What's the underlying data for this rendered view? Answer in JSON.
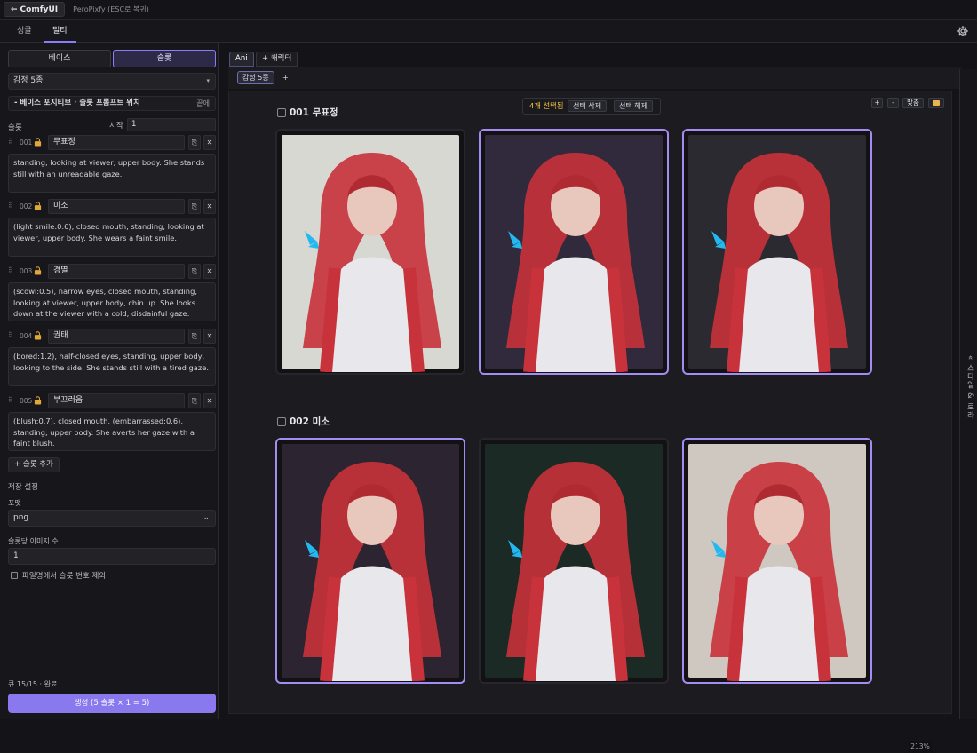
{
  "topbar": {
    "back_label": "ComfyUI",
    "app_title": "PeroPixfy (ESC로 복귀)"
  },
  "mode_tabs": [
    {
      "label": "싱글"
    },
    {
      "label": "멀티",
      "active": true
    }
  ],
  "left": {
    "seg_base": "베이스",
    "seg_slot": "슬롯",
    "preset": "감정 5종",
    "section_title": "베이스 포지티브 · 슬롯 프롬프트 위치",
    "section_fold": "끝에",
    "slot_label": "슬롯",
    "start_label": "시작",
    "start_value": "1",
    "slots": [
      {
        "num": "001",
        "name": "무표정",
        "prompt": "standing, looking at viewer, upper body. She stands still with an unreadable gaze."
      },
      {
        "num": "002",
        "name": "미소",
        "prompt": "(light smile:0.6), closed mouth, standing, looking at viewer, upper body. She wears a faint smile."
      },
      {
        "num": "003",
        "name": "경멸",
        "prompt": "(scowl:0.5), narrow eyes, closed mouth, standing, looking at viewer, upper body, chin up. She looks down at the viewer with a cold, disdainful gaze."
      },
      {
        "num": "004",
        "name": "권태",
        "prompt": "(bored:1.2), half-closed eyes, standing, upper body, looking to the side. She stands still with a tired gaze."
      },
      {
        "num": "005",
        "name": "부끄러움",
        "prompt": "(blush:0.7), closed mouth, (embarrassed:0.6), standing, upper body. She averts her gaze with a faint blush."
      }
    ],
    "add_slot": "+ 슬롯 추가",
    "save_settings": "저장 설정",
    "format_label": "포맷",
    "format_value": "png",
    "per_slot_label": "슬롯당 이미지 수",
    "per_slot_value": "1",
    "exclude_label": "파일명에서 슬롯 번호 제외",
    "queue_status": "큐 15/15 · 완료",
    "generate_label": "생성 (5 슬롯 × 1 = 5)"
  },
  "right": {
    "tabs": [
      {
        "label": "Ani",
        "active": true
      },
      {
        "label": "+ 캐릭터"
      }
    ],
    "subtabs": [
      {
        "label": "감정 5종",
        "active": true
      },
      {
        "label": "+"
      }
    ],
    "selection": {
      "count": "4개 선택됨",
      "delete": "선택 삭제",
      "clear": "선택 해제"
    },
    "zoom_controls": {
      "plus": "+",
      "minus": "-",
      "fit": "맞춤"
    },
    "groups": [
      {
        "title": "001 무표정",
        "cards": [
          {
            "selected": false,
            "bg": "#d8d8d2"
          },
          {
            "selected": true,
            "bg": "#302a3c"
          },
          {
            "selected": true,
            "bg": "#2b2a30"
          }
        ]
      },
      {
        "title": "002 미소",
        "cards": [
          {
            "selected": true,
            "bg": "#2c2430"
          },
          {
            "selected": false,
            "bg": "#1c2a26"
          },
          {
            "selected": true,
            "bg": "#cfc8c0"
          }
        ]
      }
    ],
    "zoom_level": "213%"
  },
  "side_panel": {
    "label": "« 스타일 & 로라"
  }
}
